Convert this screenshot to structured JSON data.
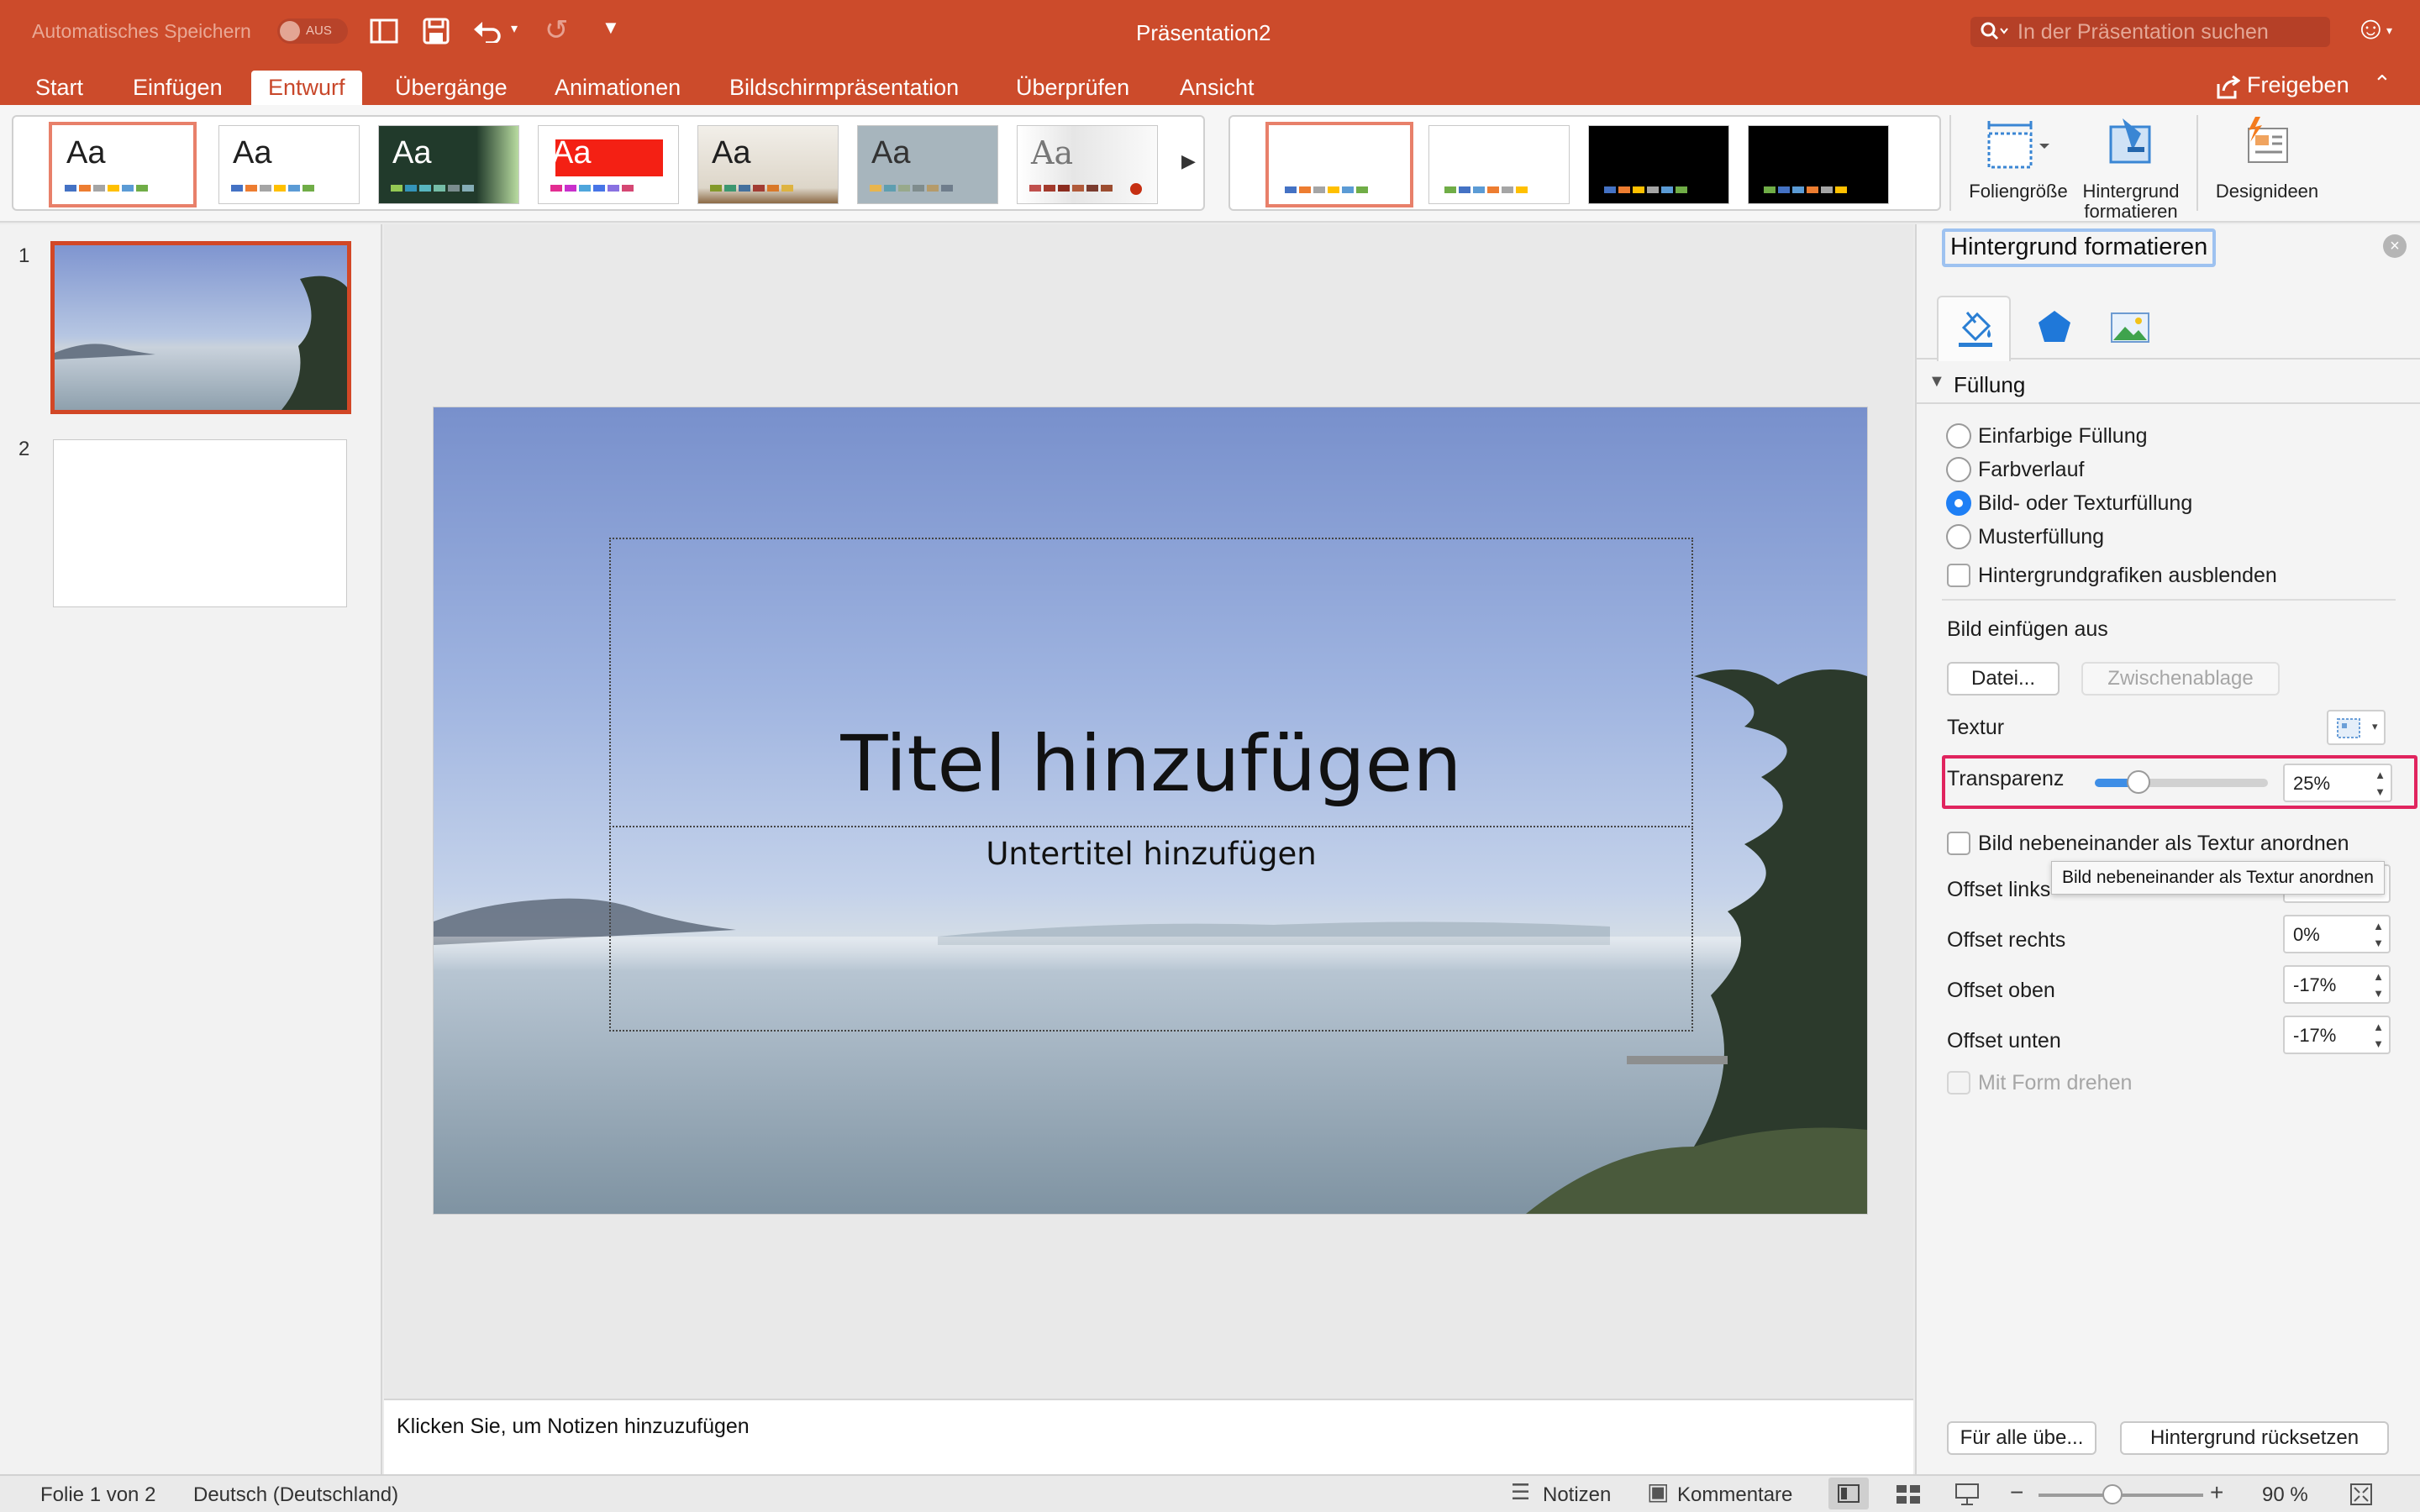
{
  "titlebar": {
    "autosave_label": "Automatisches Speichern",
    "autosave_state": "AUS",
    "doc_title": "Präsentation2",
    "search_placeholder": "In der Präsentation suchen"
  },
  "tabs": [
    {
      "label": "Start"
    },
    {
      "label": "Einfügen"
    },
    {
      "label": "Entwurf",
      "active": true
    },
    {
      "label": "Übergänge"
    },
    {
      "label": "Animationen"
    },
    {
      "label": "Bildschirmpräsentation"
    },
    {
      "label": "Überprüfen"
    },
    {
      "label": "Ansicht"
    }
  ],
  "share_label": "Freigeben",
  "ribbon": {
    "theme_glyph": "Aa",
    "slide_size_label": "Foliengröße",
    "format_bg_label_1": "Hintergrund",
    "format_bg_label_2": "formatieren",
    "design_ideas_label": "Designideen"
  },
  "thumbnails": [
    {
      "number": "1"
    },
    {
      "number": "2"
    }
  ],
  "slide": {
    "title": "Titel hinzufügen",
    "subtitle": "Untertitel hinzufügen"
  },
  "notes_placeholder": "Klicken Sie, um Notizen hinzuzufügen",
  "pane": {
    "title": "Hintergrund formatieren",
    "section": "Füllung",
    "fill_options": [
      {
        "label": "Einfarbige Füllung",
        "selected": false
      },
      {
        "label": "Farbverlauf",
        "selected": false
      },
      {
        "label": "Bild- oder Texturfüllung",
        "selected": true
      },
      {
        "label": "Musterfüllung",
        "selected": false
      }
    ],
    "hide_bg_graphics": "Hintergrundgrafiken ausblenden",
    "insert_from": "Bild einfügen aus",
    "file_button": "Datei...",
    "clipboard_button": "Zwischenablage",
    "texture_label": "Textur",
    "transparency_label": "Transparenz",
    "transparency_value": "25%",
    "transparency_level": 0.25,
    "tile_label": "Bild nebeneinander als Textur anordnen",
    "tooltip": "Bild nebeneinander als Textur anordnen",
    "offset_left_label": "Offset links",
    "offset_right_label": "Offset rechts",
    "offset_right_value": "0%",
    "offset_top_label": "Offset oben",
    "offset_top_value": "-17%",
    "offset_bottom_label": "Offset unten",
    "offset_bottom_value": "-17%",
    "rotate_label": "Mit Form drehen",
    "apply_all_button": "Für alle übe...",
    "reset_button": "Hintergrund rücksetzen"
  },
  "status": {
    "slide_info": "Folie 1 von 2",
    "language": "Deutsch (Deutschland)",
    "notes": "Notizen",
    "comments": "Kommentare",
    "zoom": "90 %",
    "zoom_level": 0.45
  },
  "colors": {
    "accent": "#cc4b2b",
    "highlight": "#e0245e",
    "radio_selected": "#1e7ff5"
  }
}
